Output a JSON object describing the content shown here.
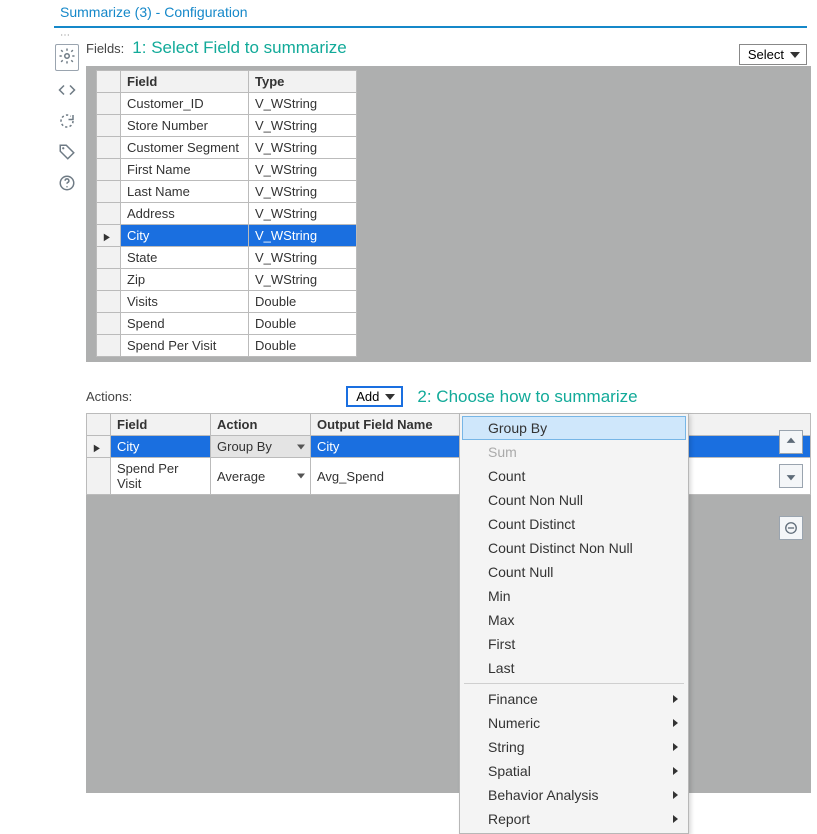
{
  "header": {
    "title": "Summarize (3) - Configuration"
  },
  "step1": {
    "fields_label": "Fields:",
    "title": "1: Select Field to summarize",
    "select_btn": "Select",
    "columns": {
      "field": "Field",
      "type": "Type"
    },
    "rows": [
      {
        "field": "Customer_ID",
        "type": "V_WString"
      },
      {
        "field": "Store Number",
        "type": "V_WString"
      },
      {
        "field": "Customer Segment",
        "type": "V_WString"
      },
      {
        "field": "First Name",
        "type": "V_WString"
      },
      {
        "field": "Last Name",
        "type": "V_WString"
      },
      {
        "field": "Address",
        "type": "V_WString"
      },
      {
        "field": "City",
        "type": "V_WString"
      },
      {
        "field": "State",
        "type": "V_WString"
      },
      {
        "field": "Zip",
        "type": "V_WString"
      },
      {
        "field": "Visits",
        "type": "Double"
      },
      {
        "field": "Spend",
        "type": "Double"
      },
      {
        "field": "Spend Per Visit",
        "type": "Double"
      }
    ],
    "selected_index": 6
  },
  "step2": {
    "actions_label": "Actions:",
    "add_btn": "Add",
    "title": "2: Choose how to summarize",
    "columns": {
      "field": "Field",
      "action": "Action",
      "out": "Output Field Name"
    },
    "rows": [
      {
        "field": "City",
        "action": "Group By",
        "out": "City"
      },
      {
        "field": "Spend Per Visit",
        "action": "Average",
        "out": "Avg_Spend"
      }
    ]
  },
  "menu": {
    "items": [
      {
        "label": "Group By",
        "hl": true
      },
      {
        "label": "Sum",
        "disabled": true
      },
      {
        "label": "Count"
      },
      {
        "label": "Count Non Null"
      },
      {
        "label": "Count Distinct"
      },
      {
        "label": "Count Distinct Non Null"
      },
      {
        "label": "Count Null"
      },
      {
        "label": "Min"
      },
      {
        "label": "Max"
      },
      {
        "label": "First"
      },
      {
        "label": "Last"
      }
    ],
    "submenus": [
      {
        "label": "Finance"
      },
      {
        "label": "Numeric"
      },
      {
        "label": "String"
      },
      {
        "label": "Spatial"
      },
      {
        "label": "Behavior Analysis"
      },
      {
        "label": "Report"
      }
    ]
  }
}
